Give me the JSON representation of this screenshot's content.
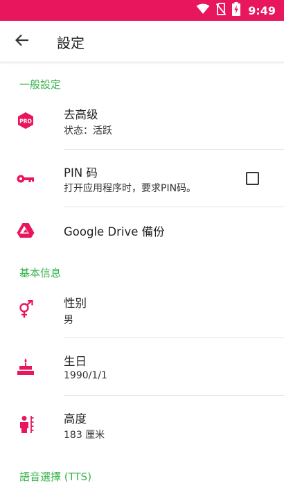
{
  "status_bar": {
    "time": "9:49",
    "icons": [
      "wifi-icon",
      "no-sim-icon",
      "battery-charging-icon"
    ],
    "color": "#e8175d"
  },
  "app_bar": {
    "title": "設定",
    "back_icon": "arrow-back-icon"
  },
  "accent_color": "#e8175d",
  "section_color": "#38b34a",
  "sections": [
    {
      "header": "一般設定",
      "items": [
        {
          "icon": "pro-badge-icon",
          "title": "去高级",
          "subtitle": "状态：活跃"
        },
        {
          "icon": "key-icon",
          "title": "PIN 码",
          "subtitle": "打开应用程序时，要求PIN码。",
          "checkbox_checked": false
        },
        {
          "icon": "google-drive-icon",
          "title": "Google Drive 備份"
        }
      ]
    },
    {
      "header": "基本信息",
      "items": [
        {
          "icon": "gender-icon",
          "title": "性别",
          "subtitle": "男"
        },
        {
          "icon": "birthday-cake-icon",
          "title": "生日",
          "subtitle": "1990/1/1"
        },
        {
          "icon": "height-icon",
          "title": "高度",
          "subtitle": "183 厘米"
        }
      ]
    },
    {
      "header": "語音選擇 (TTS)"
    }
  ]
}
